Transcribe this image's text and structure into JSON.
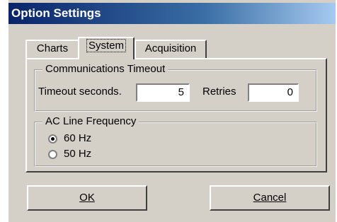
{
  "window": {
    "title": "Option Settings"
  },
  "tabs": [
    {
      "label": "Charts",
      "active": false
    },
    {
      "label": "System",
      "active": true
    },
    {
      "label": "Acquisition",
      "active": false
    }
  ],
  "communications": {
    "title": "Communications Timeout",
    "timeout_label": "Timeout seconds.",
    "timeout_value": "5",
    "retries_label": "Retries",
    "retries_value": "0"
  },
  "ac_line": {
    "title": "AC Line Frequency",
    "options": [
      {
        "label": "60 Hz",
        "selected": true
      },
      {
        "label": "50 Hz",
        "selected": false
      }
    ]
  },
  "buttons": {
    "ok_label": "OK",
    "cancel_label": "Cancel"
  }
}
